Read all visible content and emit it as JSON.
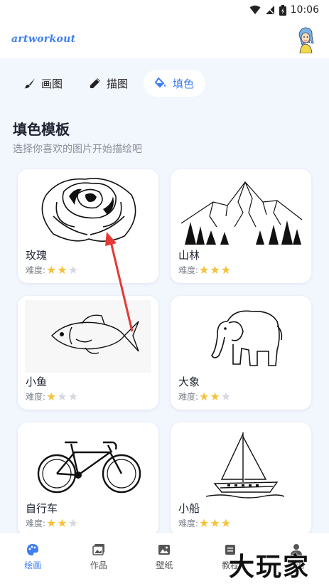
{
  "status_bar": {
    "time": "10:06"
  },
  "app": {
    "logo_text": "artworkout"
  },
  "tabs": [
    {
      "label": "画图",
      "icon": "brush-icon",
      "active": false
    },
    {
      "label": "描图",
      "icon": "pencil-icon",
      "active": false
    },
    {
      "label": "填色",
      "icon": "paint-bucket-icon",
      "active": true
    }
  ],
  "section": {
    "title": "填色模板",
    "subtitle": "选择你喜欢的图片开始描绘吧"
  },
  "difficulty_label": "难度:",
  "cards": [
    {
      "name": "玫瑰",
      "icon": "rose-illustration",
      "stars": 2
    },
    {
      "name": "山林",
      "icon": "mountain-forest-illustration",
      "stars": 3
    },
    {
      "name": "小鱼",
      "icon": "fish-illustration",
      "stars": 1
    },
    {
      "name": "大象",
      "icon": "elephant-illustration",
      "stars": 2
    },
    {
      "name": "自行车",
      "icon": "bicycle-illustration",
      "stars": 2
    },
    {
      "name": "小船",
      "icon": "sailboat-illustration",
      "stars": 3
    }
  ],
  "bottom_nav": [
    {
      "label": "绘画",
      "icon": "palette-icon",
      "active": true
    },
    {
      "label": "作品",
      "icon": "gallery-icon",
      "active": false
    },
    {
      "label": "壁纸",
      "icon": "image-icon",
      "active": false
    },
    {
      "label": "教程",
      "icon": "tutorial-icon",
      "active": false
    },
    {
      "label": "我的",
      "icon": "person-icon",
      "active": false
    }
  ],
  "watermark": "大玩家",
  "colors": {
    "accent": "#3f7ef0",
    "star": "#f6c23a",
    "background": "#f2f6fd",
    "annotation_arrow": "#e53935"
  }
}
